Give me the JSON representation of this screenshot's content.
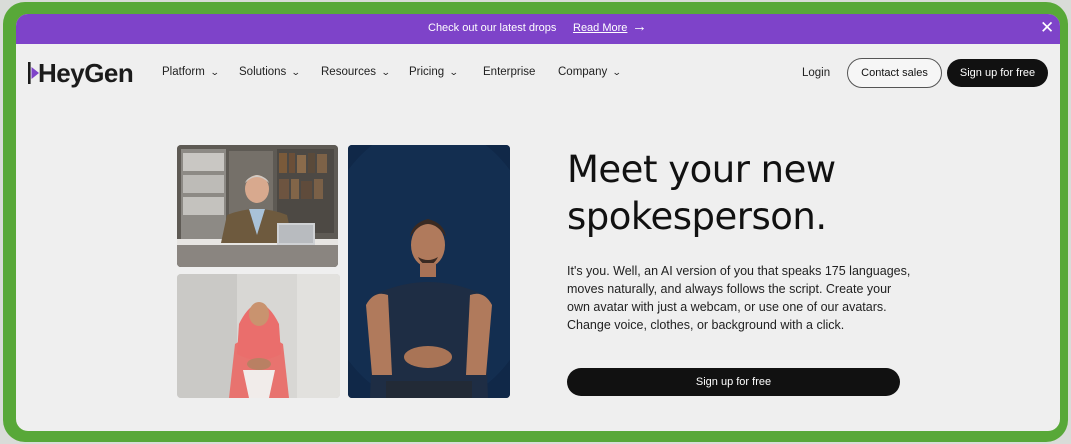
{
  "banner": {
    "text": "Check out our latest drops",
    "link": "Read More",
    "arrow": "→",
    "close": "✕",
    "color": "#7e43c9"
  },
  "header": {
    "logo": "HeyGen",
    "nav": [
      "Platform",
      "Solutions",
      "Resources",
      "Pricing",
      "Enterprise",
      "Company"
    ],
    "login": "Login",
    "contact_sales": "Contact sales",
    "signup": "Sign up for free"
  },
  "hero": {
    "headline_line1": "Meet your new",
    "headline_line2": "spokesperson.",
    "body": "It's you. Well, an AI version of you that speaks 175 languages, moves naturally, and always follows the script. Create your own avatar with just a webcam, or use one of our avatars. Change voice, clothes, or background with a click.",
    "cta": "Sign up for free"
  },
  "icons": {
    "chevron": "chevron-down-icon",
    "arrow": "arrow-right-icon",
    "close": "close-icon"
  }
}
